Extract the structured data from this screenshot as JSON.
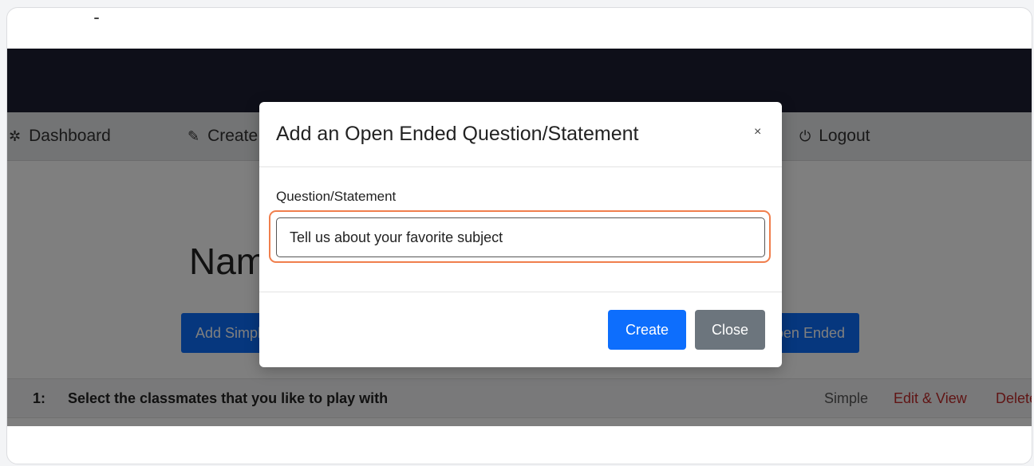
{
  "nav": {
    "items": [
      {
        "label": "Dashboard",
        "icon": "dashboard-icon"
      },
      {
        "label": "Create",
        "icon": "pencil-icon"
      },
      {
        "label": "Logout",
        "icon": "power-icon"
      }
    ]
  },
  "page": {
    "title": "Name of Survey",
    "buttons": {
      "add_simple": "Add Simple",
      "add_open_ended": "Add Open Ended"
    }
  },
  "questions": [
    {
      "number": "1:",
      "text": "Select the classmates that you like to play with",
      "type": "Simple",
      "edit_label": "Edit & View",
      "delete_label": "Delete"
    }
  ],
  "modal": {
    "title": "Add an Open Ended Question/Statement",
    "close_glyph": "×",
    "field_label": "Question/Statement",
    "field_value": "Tell us about your favorite subject",
    "create_label": "Create",
    "close_label": "Close"
  },
  "colors": {
    "header_bg": "#1d1e33",
    "primary": "#0d6efd",
    "secondary": "#6c757d",
    "danger_text": "#c02b2b",
    "focus_ring": "#f07e4c"
  }
}
